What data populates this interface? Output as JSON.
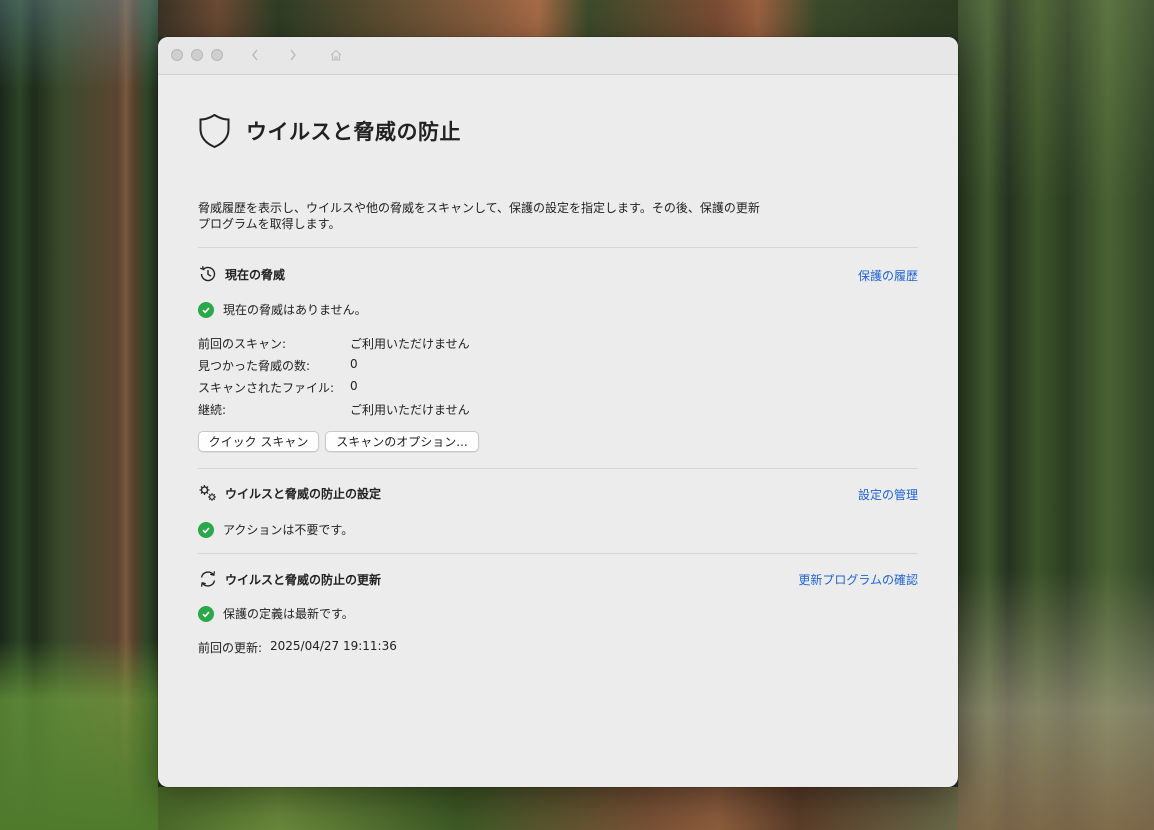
{
  "window": {
    "title": "ウイルスと脅威の防止"
  },
  "header": {
    "description": "脅威履歴を表示し、ウイルスや他の脅威をスキャンして、保護の設定を指定します。その後、保護の更新プログラムを取得します。"
  },
  "current_threats": {
    "title": "現在の脅威",
    "link": "保護の履歴",
    "status": "現在の脅威はありません。",
    "rows": [
      {
        "label": "前回のスキャン:",
        "value": "ご利用いただけません"
      },
      {
        "label": "見つかった脅威の数:",
        "value": "0"
      },
      {
        "label": "スキャンされたファイル:",
        "value": "0"
      },
      {
        "label": "継続:",
        "value": "ご利用いただけません"
      }
    ],
    "quick_scan_label": "クイック スキャン",
    "scan_options_label": "スキャンのオプション..."
  },
  "settings": {
    "title": "ウイルスと脅威の防止の設定",
    "link": "設定の管理",
    "status": "アクションは不要です。"
  },
  "updates": {
    "title": "ウイルスと脅威の防止の更新",
    "link": "更新プログラムの確認",
    "status": "保護の定義は最新です。",
    "last_update_label": "前回の更新:",
    "last_update_value": "2025/04/27 19:11:36"
  },
  "icons": {
    "title_icon": "shield-icon",
    "threats_icon": "history-icon",
    "settings_icon": "gears-icon",
    "updates_icon": "refresh-icon",
    "status_icon": "check-circle-icon"
  },
  "colors": {
    "link": "#1f63d4",
    "success": "#2aa84a",
    "window_bg": "#ececec"
  }
}
